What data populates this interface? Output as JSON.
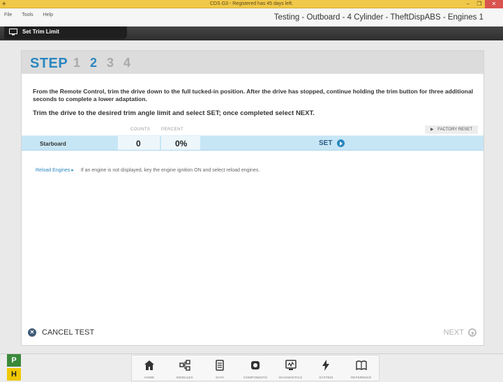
{
  "window": {
    "title": "CDS G3 - Registered has 45 days left.",
    "controls": [
      "–",
      "❐",
      "✕"
    ]
  },
  "menu": {
    "items": [
      "File",
      "Tools",
      "Help"
    ],
    "context_title": "Testing - Outboard - 4 Cylinder - TheftDispABS - Engines 1"
  },
  "screen": {
    "title": "Set Trim Limit"
  },
  "step": {
    "label": "STEP",
    "numbers": [
      "1",
      "2",
      "3",
      "4"
    ],
    "active_index": 1
  },
  "instructions": {
    "line1": "From the Remote Control, trim the drive down to the full tucked-in position. After the drive has stopped, continue holding the trim button for three additional seconds to complete a lower adaptation.",
    "line2": "Trim the drive to the desired trim angle limit and select SET; once completed select NEXT."
  },
  "table": {
    "col_counts": "COUNTS",
    "col_percent": "PERCENT",
    "factory_reset": "FACTORY RESET",
    "row": {
      "engine": "Starboard",
      "counts": "0",
      "percent": "0%",
      "set_label": "SET"
    }
  },
  "reload": {
    "link": "Reload Engines ▸",
    "description": "If an engine is not displayed, key the engine ignition ON and select reload engines."
  },
  "footer": {
    "cancel": "CANCEL TEST",
    "next": "NEXT"
  },
  "status": {
    "p": "P",
    "h": "H"
  },
  "nav": [
    {
      "label": "HOME",
      "icon": "home-icon"
    },
    {
      "label": "MODULES",
      "icon": "modules-icon"
    },
    {
      "label": "DATA",
      "icon": "data-icon"
    },
    {
      "label": "COMPONENTS",
      "icon": "components-icon"
    },
    {
      "label": "DIAGNOSTICS",
      "icon": "diagnostics-icon"
    },
    {
      "label": "SYSTEM",
      "icon": "system-icon"
    },
    {
      "label": "REFERENCE",
      "icon": "reference-icon"
    }
  ],
  "colors": {
    "accent": "#2a87c0",
    "row_highlight": "#c7e6f5",
    "title_bar": "#f0c84a",
    "status_p": "#3a8a3a",
    "status_h": "#f0c800"
  }
}
